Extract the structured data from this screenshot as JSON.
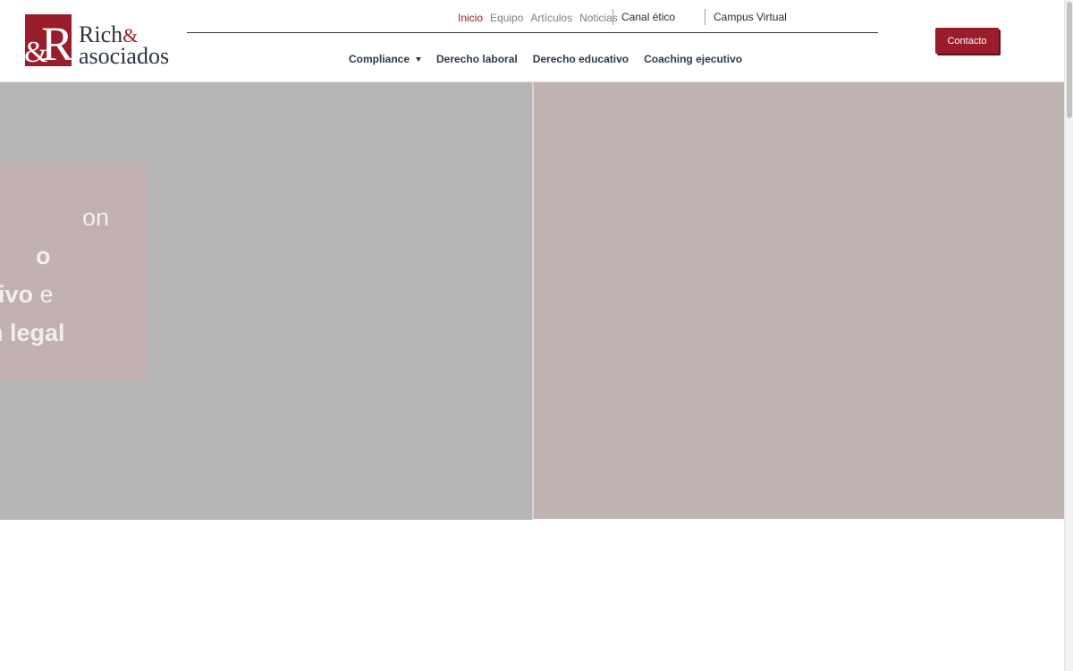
{
  "logo": {
    "mark_amp": "&",
    "mark_letter": "R",
    "word1": "Rich",
    "word1_amp": "&",
    "word2": "asociados"
  },
  "top_nav": [
    {
      "label": "Inicio",
      "active": true
    },
    {
      "label": "Equipo",
      "active": false
    },
    {
      "label": "Artículos",
      "active": false
    },
    {
      "label": "Noticias",
      "active": false
    }
  ],
  "canal_etico": "Canal ético",
  "campus_virtual": "Campus Virtual",
  "main_nav": {
    "compliance": "Compliance",
    "derecho_laboral": "Derecho laboral",
    "derecho_educativo": "Derecho educativo",
    "coaching": "Coaching ejecutivo"
  },
  "contact_button": "Contacto",
  "hero": {
    "line1": "on",
    "line2": "o",
    "line3_bold": "ivo",
    "line3_light": " e",
    "line4": "ción legal"
  },
  "colors": {
    "brand": "#9b1c2a",
    "nav_text": "#2d3a48",
    "hero_left": "#b6b6b6",
    "hero_right": "#c2b3b3"
  }
}
